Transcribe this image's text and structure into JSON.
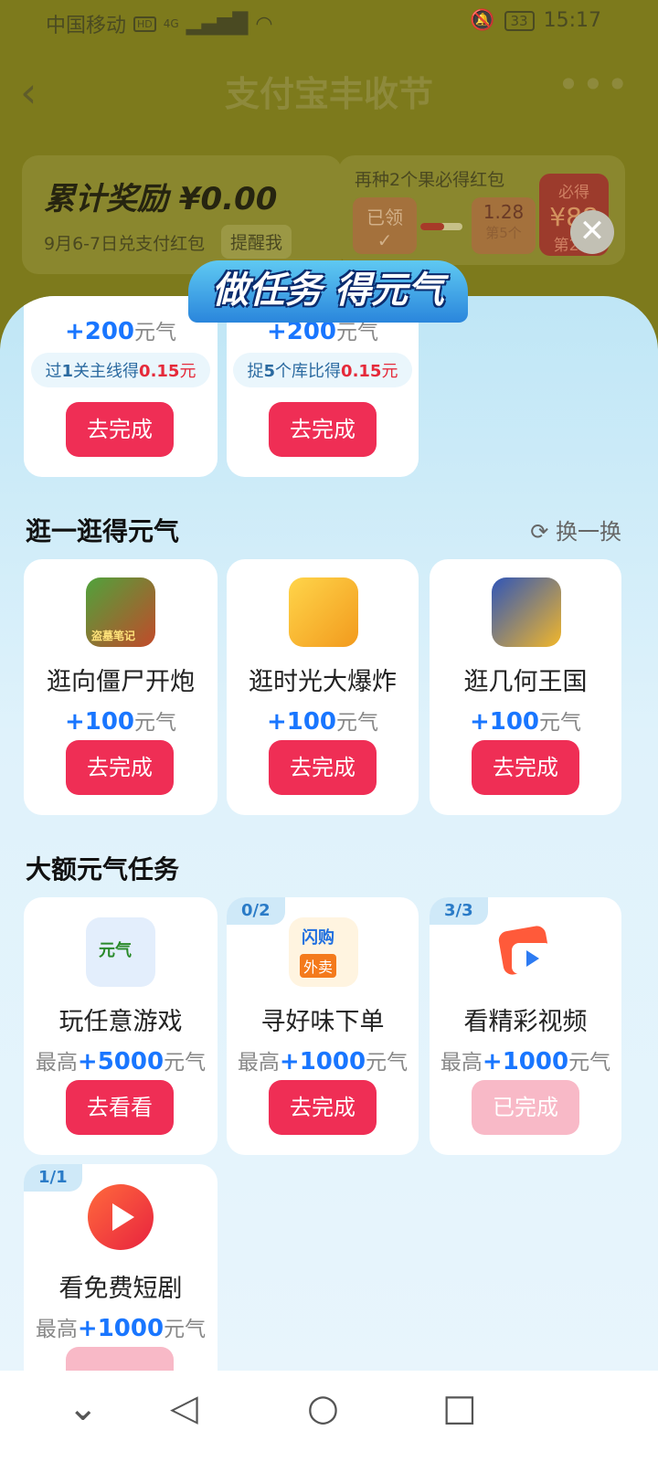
{
  "status": {
    "carrier": "中国移动",
    "net_badge": "HD",
    "net_type": "4G",
    "battery": "33",
    "time": "15:17"
  },
  "header": {
    "title": "支付宝丰收节"
  },
  "reward": {
    "title": "累计奖励 ¥0.00",
    "subtitle": "9月6-7日兑支付红包",
    "remind": "提醒我"
  },
  "pack": {
    "text": "再种2个果必得红包",
    "claimed": "已领",
    "value": "1.28",
    "day": "第5个",
    "must_get": "必得",
    "big": "¥88",
    "big_day": "第2个"
  },
  "panel": {
    "banner": "做任务 得元气"
  },
  "top_cards": [
    {
      "reward_prefix": "+200",
      "reward_unit": "元气",
      "pill_a": "过",
      "pill_num": "1",
      "pill_b": "关主线得",
      "pill_money": "0.15",
      "pill_unit": "元",
      "button": "去完成"
    },
    {
      "reward_prefix": "+200",
      "reward_unit": "元气",
      "pill_a": "捉",
      "pill_num": "5",
      "pill_b": "个库比得",
      "pill_money": "0.15",
      "pill_unit": "元",
      "button": "去完成"
    }
  ],
  "browse": {
    "title": "逛一逛得元气",
    "refresh": "换一换",
    "items": [
      {
        "name": "逛向僵尸开炮",
        "reward": "+100",
        "unit": "元气",
        "button": "去完成"
      },
      {
        "name": "逛时光大爆炸",
        "reward": "+100",
        "unit": "元气",
        "button": "去完成"
      },
      {
        "name": "逛几何王国",
        "reward": "+100",
        "unit": "元气",
        "button": "去完成"
      }
    ]
  },
  "big": {
    "title": "大额元气任务",
    "items": [
      {
        "progress": "",
        "name": "玩任意游戏",
        "prefix": "最高",
        "reward": "+5000",
        "unit": "元气",
        "button": "去看看",
        "done": false
      },
      {
        "progress": "0/2",
        "name": "寻好味下单",
        "prefix": "最高",
        "reward": "+1000",
        "unit": "元气",
        "button": "去完成",
        "done": false
      },
      {
        "progress": "3/3",
        "name": "看精彩视频",
        "prefix": "最高",
        "reward": "+1000",
        "unit": "元气",
        "button": "已完成",
        "done": true
      },
      {
        "progress": "1/1",
        "name": "看免费短剧",
        "prefix": "最高",
        "reward": "+1000",
        "unit": "元气",
        "button": "",
        "done": true
      }
    ],
    "icon_texts": [
      "元气",
      "闪购",
      "外卖",
      "盗墓笔记"
    ]
  }
}
